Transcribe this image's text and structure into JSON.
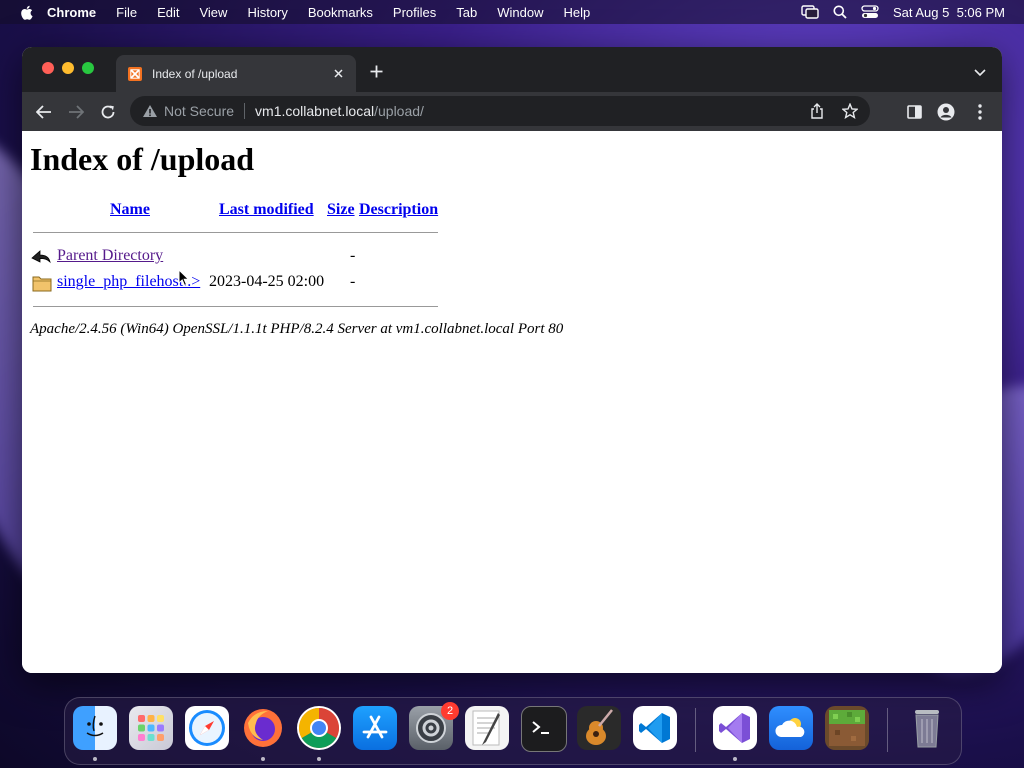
{
  "menubar": {
    "app_name": "Chrome",
    "items": [
      "File",
      "Edit",
      "View",
      "History",
      "Bookmarks",
      "Profiles",
      "Tab",
      "Window",
      "Help"
    ],
    "datetime": "Sat Aug 5  5:06 PM"
  },
  "browser": {
    "tab_title": "Index of /upload",
    "address": {
      "security_label": "Not Secure",
      "host": "vm1.collabnet.local",
      "path": "/upload/"
    }
  },
  "page": {
    "heading": "Index of /upload",
    "columns": {
      "name": "Name",
      "last_modified": "Last modified",
      "size": "Size",
      "description": "Description"
    },
    "rows": [
      {
        "name": "Parent Directory",
        "modified": "",
        "size": "-",
        "icon": "back-icon"
      },
      {
        "name": "single_php_filehost..>",
        "modified": "2023-04-25 02:00",
        "size": "-",
        "icon": "folder-icon"
      }
    ],
    "server_signature": "Apache/2.4.56 (Win64) OpenSSL/1.1.1t PHP/8.2.4 Server at vm1.collabnet.local Port 80"
  },
  "dock": {
    "items": [
      "Finder",
      "Launchpad",
      "Safari",
      "Firefox",
      "Chrome",
      "App Store",
      "System Settings",
      "TextEdit",
      "Terminal",
      "GarageBand",
      "Visual Studio Code",
      "Visual Studio",
      "Weather",
      "Minecraft",
      "Trash"
    ],
    "settings_badge": "2"
  },
  "colors": {
    "link_visited": "#551a8b",
    "link": "#0000ee",
    "chrome_dark": "#202124",
    "chrome_toolbar": "#35363a"
  }
}
